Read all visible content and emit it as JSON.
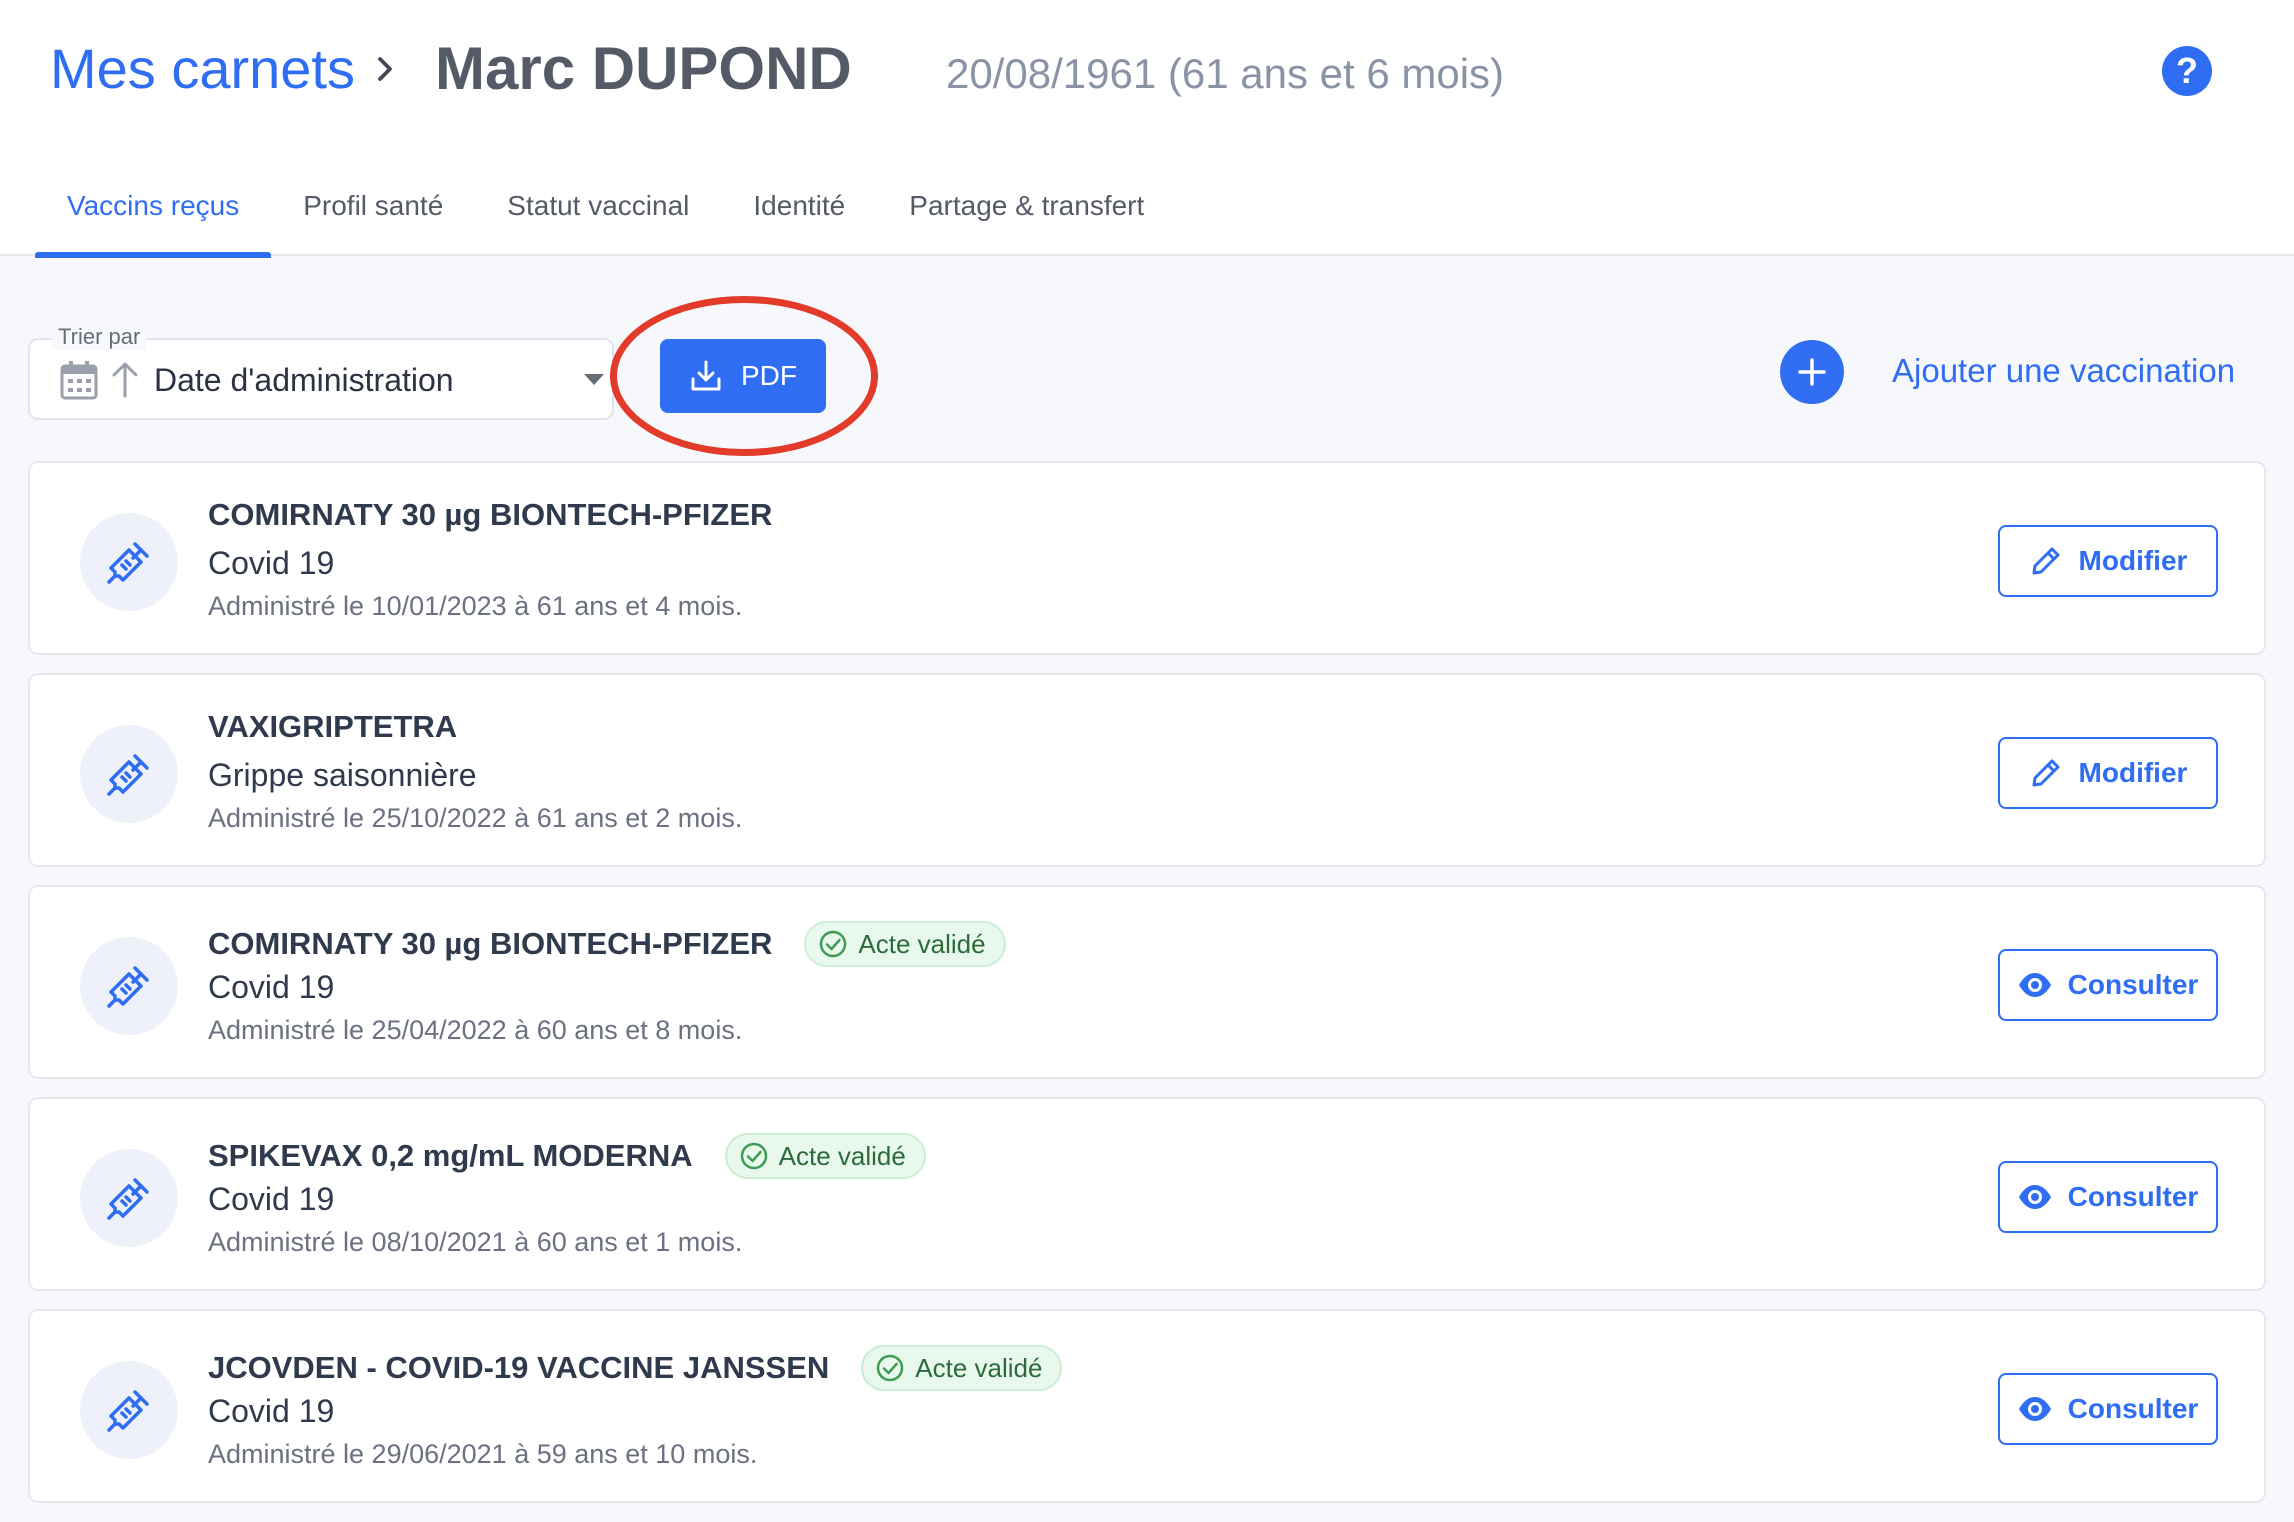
{
  "header": {
    "breadcrumb_root": "Mes carnets",
    "patient_name": "Marc DUPOND",
    "birthdate": "20/08/1961 (61 ans et 6 mois)",
    "help_label": "?"
  },
  "tabs": [
    {
      "label": "Vaccins reçus",
      "active": true
    },
    {
      "label": "Profil santé",
      "active": false
    },
    {
      "label": "Statut vaccinal",
      "active": false
    },
    {
      "label": "Identité",
      "active": false
    },
    {
      "label": "Partage & transfert",
      "active": false
    }
  ],
  "toolbar": {
    "sort_legend": "Trier par",
    "sort_value": "Date d'administration",
    "pdf_label": "PDF",
    "add_label": "Ajouter une vaccination"
  },
  "vaccinations": [
    {
      "name": "COMIRNATY 30 µg BIONTECH-PFIZER",
      "disease": "Covid 19",
      "date_text": "Administré le 10/01/2023 à 61 ans et 4 mois.",
      "badge": "",
      "action": "Modifier"
    },
    {
      "name": "VAXIGRIPTETRA",
      "disease": "Grippe saisonnière",
      "date_text": "Administré le 25/10/2022 à 61 ans et 2 mois.",
      "badge": "",
      "action": "Modifier"
    },
    {
      "name": "COMIRNATY 30 µg BIONTECH-PFIZER",
      "disease": "Covid 19",
      "date_text": "Administré le 25/04/2022 à 60 ans et 8 mois.",
      "badge": "Acte validé",
      "action": "Consulter"
    },
    {
      "name": "SPIKEVAX 0,2 mg/mL MODERNA",
      "disease": "Covid 19",
      "date_text": "Administré le 08/10/2021 à 60 ans et 1 mois.",
      "badge": "Acte validé",
      "action": "Consulter"
    },
    {
      "name": "JCOVDEN - COVID-19 VACCINE JANSSEN",
      "disease": "Covid 19",
      "date_text": "Administré le 29/06/2021 à 59 ans et 10 mois.",
      "badge": "Acte validé",
      "action": "Consulter"
    }
  ],
  "colors": {
    "primary": "#2f6df2",
    "highlight_ring": "#e23b2a",
    "badge_bg": "#e9f8ec",
    "badge_text": "#2b6b3b"
  }
}
